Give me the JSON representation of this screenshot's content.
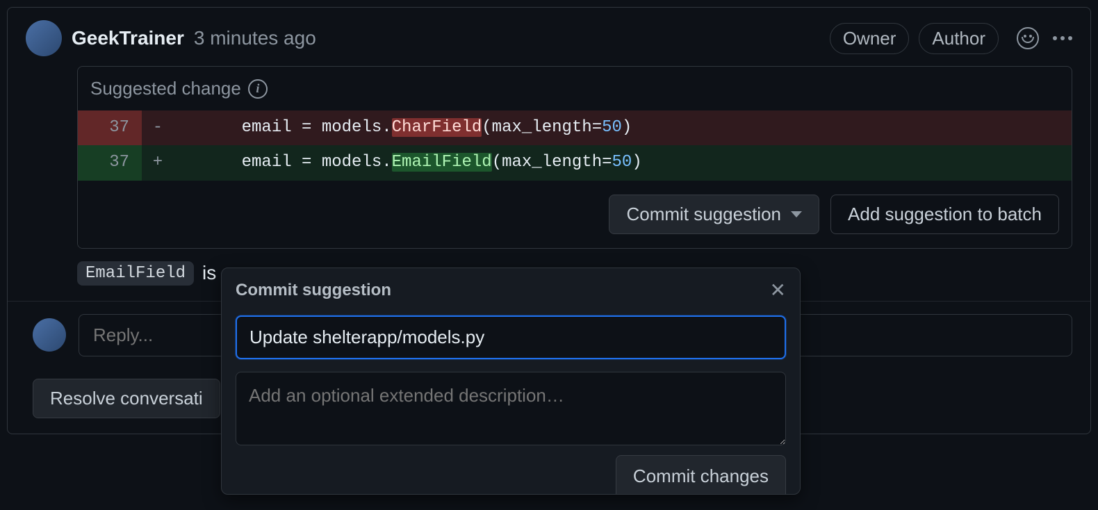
{
  "comment": {
    "author": "GeekTrainer",
    "timestamp": "3 minutes ago",
    "badges": {
      "owner": "Owner",
      "author": "Author"
    }
  },
  "suggestion": {
    "header": "Suggested change",
    "diff": {
      "del": {
        "num": "37",
        "sign": "-",
        "prefix": "    email = models.",
        "highlight": "CharField",
        "suffix_a": "(max_length=",
        "value": "50",
        "suffix_b": ")"
      },
      "add": {
        "num": "37",
        "sign": "+",
        "prefix": "    email = models.",
        "highlight": "EmailField",
        "suffix_a": "(max_length=",
        "value": "50",
        "suffix_b": ")"
      }
    },
    "actions": {
      "commit": "Commit suggestion",
      "batch": "Add suggestion to batch"
    }
  },
  "body": {
    "chip": "EmailField",
    "text": "is a"
  },
  "reply": {
    "placeholder": "Reply..."
  },
  "resolve": {
    "label": "Resolve conversati"
  },
  "popover": {
    "title": "Commit suggestion",
    "message": "Update shelterapp/models.py",
    "description_placeholder": "Add an optional extended description…",
    "commit": "Commit changes"
  }
}
